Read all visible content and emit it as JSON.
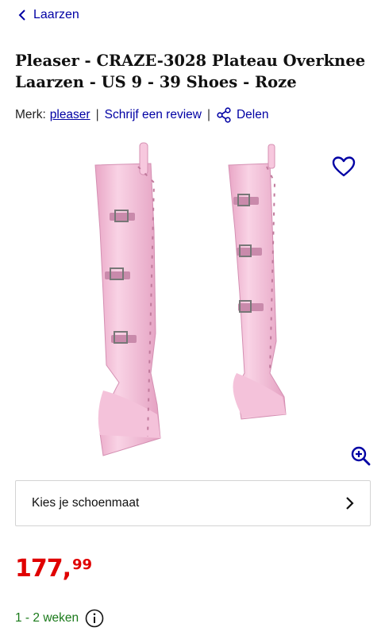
{
  "nav": {
    "back_label": "Laarzen"
  },
  "product": {
    "title": "Pleaser - CRAZE-3028 Plateau Overknee Laarzen - US 9 - 39 Shoes - Roze",
    "brand_prefix": "Merk:",
    "brand": "pleaser",
    "review_link": "Schrijf een review",
    "share_label": "Delen"
  },
  "size_select": {
    "label": "Kies je schoenmaat"
  },
  "price": {
    "whole": "177,",
    "cents": "99"
  },
  "delivery": {
    "text": "1 - 2 weken"
  },
  "colors": {
    "accent": "#0000a4",
    "price": "#e00000",
    "delivery": "#1a7a1a",
    "boot": "#f2b8d4"
  },
  "icons": [
    "chevron-left-icon",
    "share-icon",
    "heart-icon",
    "zoom-in-icon",
    "chevron-right-icon",
    "info-icon"
  ]
}
